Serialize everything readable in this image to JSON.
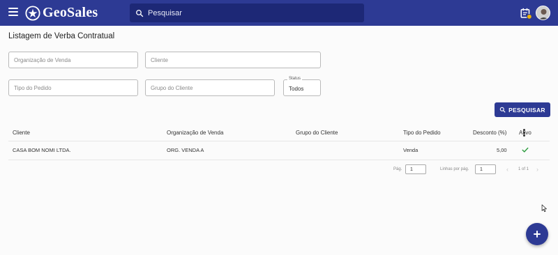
{
  "header": {
    "logo_text": "GeoSales",
    "search_placeholder": "Pesquisar",
    "brand_color": "#2d3a94",
    "icons": [
      "menu-icon",
      "search-icon",
      "calendar-notification-icon",
      "avatar"
    ]
  },
  "page": {
    "title": "Listagem de Verba Contratual"
  },
  "filters": {
    "organizacao_placeholder": "Organização de Venda",
    "cliente_placeholder": "Cliente",
    "tipo_pedido_placeholder": "Tipo do Pedido",
    "grupo_cliente_placeholder": "Grupo do Cliente",
    "status_label": "Status",
    "status_value": "Todos",
    "search_button": "PESQUISAR"
  },
  "table": {
    "headers": {
      "cliente": "Cliente",
      "organizacao": "Organização de Venda",
      "grupo": "Grupo do Cliente",
      "tipo": "Tipo do Pedido",
      "desconto": "Desconto (%)",
      "ativo": "Ativo"
    },
    "rows": [
      {
        "cliente": "CASA BOM NOMI LTDA.",
        "organizacao": "ORG. VENDA A",
        "grupo": "",
        "tipo": "Venda",
        "desconto": "5,00",
        "ativo": true
      }
    ]
  },
  "pagination": {
    "page_label": "Pág.",
    "page_value": "1",
    "rows_label": "Linhas por pág.",
    "rows_value": "1",
    "count": "1 of 1"
  },
  "fab": {
    "icon": "plus-icon"
  }
}
